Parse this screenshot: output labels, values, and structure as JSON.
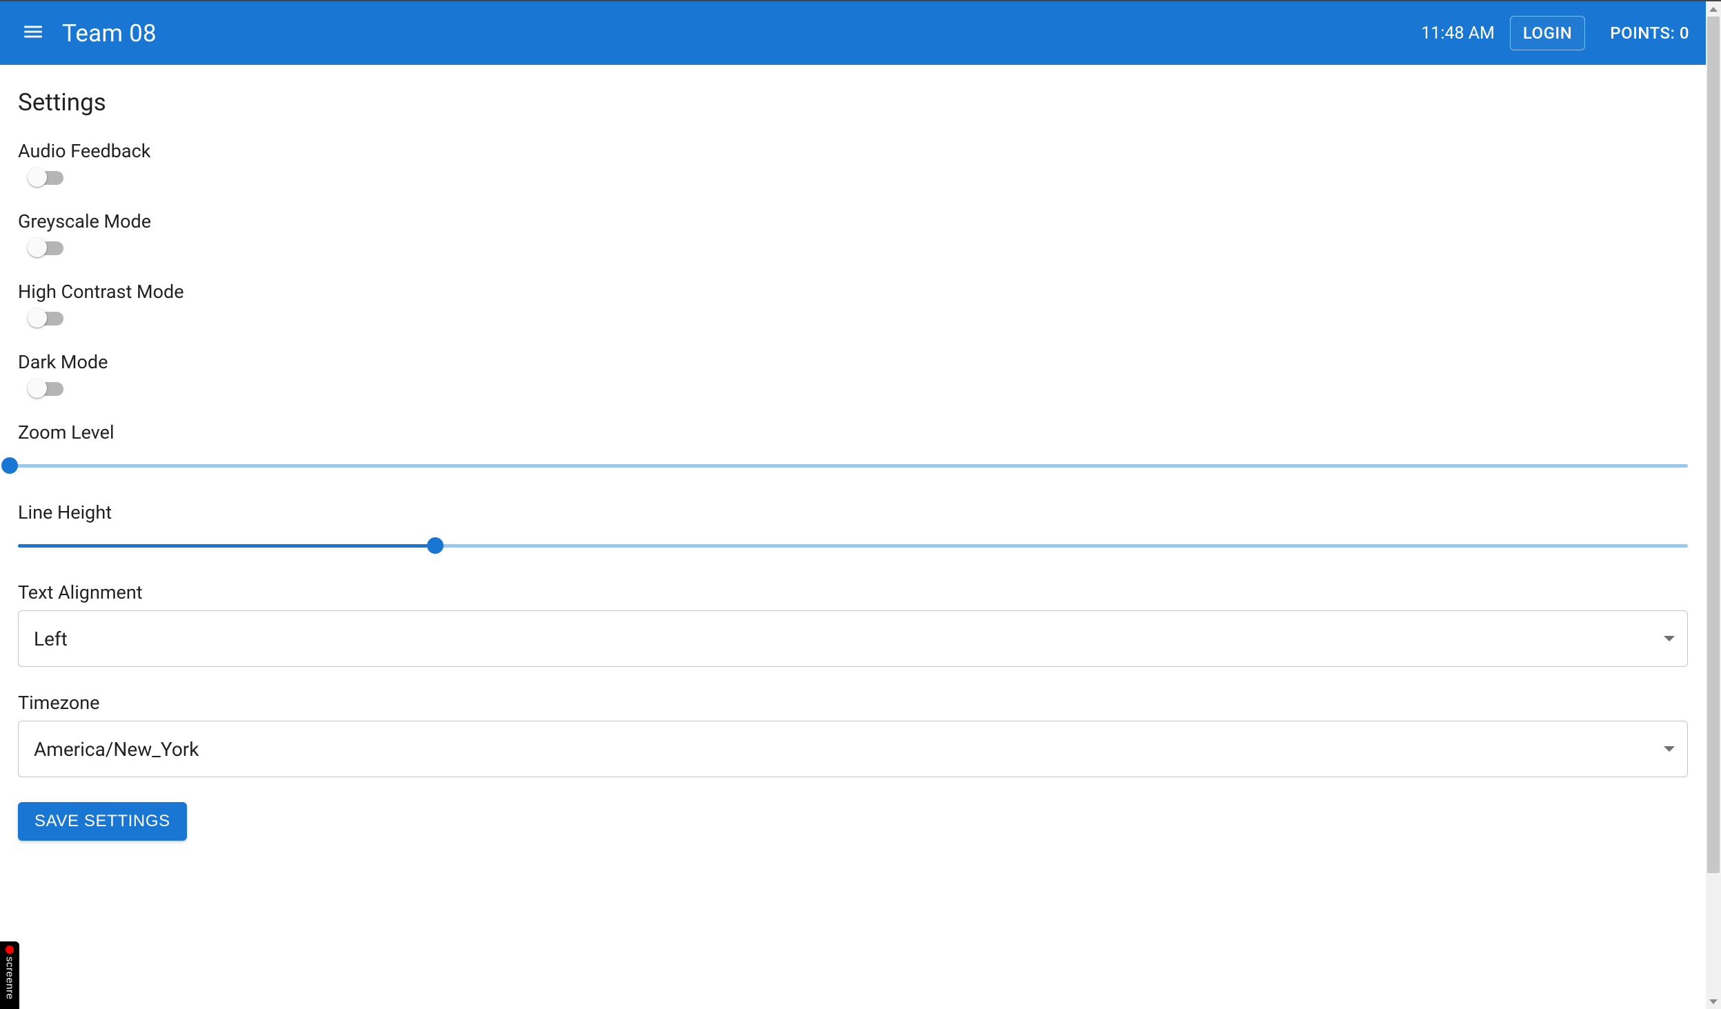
{
  "header": {
    "app_title": "Team 08",
    "clock": "11:48 AM",
    "login_label": "LOGIN",
    "points_label": "POINTS: 0"
  },
  "page": {
    "title": "Settings",
    "save_button_label": "SAVE SETTINGS"
  },
  "settings": {
    "audio_feedback": {
      "label": "Audio Feedback",
      "value": false
    },
    "greyscale_mode": {
      "label": "Greyscale Mode",
      "value": false
    },
    "high_contrast_mode": {
      "label": "High Contrast Mode",
      "value": false
    },
    "dark_mode": {
      "label": "Dark Mode",
      "value": false
    },
    "zoom_level": {
      "label": "Zoom Level",
      "value_percent": 0
    },
    "line_height": {
      "label": "Line Height",
      "value_percent": 25
    },
    "text_alignment": {
      "label": "Text Alignment",
      "value": "Left"
    },
    "timezone": {
      "label": "Timezone",
      "value": "America/New_York"
    }
  },
  "screenrec_label": "screenre"
}
